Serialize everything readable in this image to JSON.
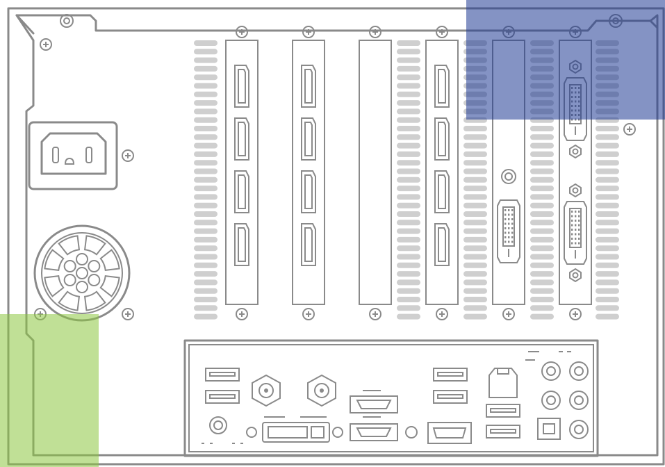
{
  "figure": {
    "kind": "computer rear panel line illustration",
    "stroke_color": "#8a8a8a",
    "vent_color": "#cfcfcf",
    "highlights": [
      {
        "name": "top-right-region",
        "color": "#1f3a93",
        "opacity": 0.55
      },
      {
        "name": "bottom-left-region",
        "color": "#8cc63f",
        "opacity": 0.55
      }
    ],
    "expansion_slots": [
      {
        "name": "gpu-card-1",
        "ports": [
          "displayport",
          "displayport",
          "displayport",
          "displayport"
        ]
      },
      {
        "name": "gpu-card-2",
        "ports": [
          "displayport",
          "displayport",
          "displayport",
          "displayport"
        ]
      },
      {
        "name": "blank-slot-cover",
        "ports": []
      },
      {
        "name": "gpu-card-3",
        "ports": [
          "displayport",
          "displayport",
          "displayport",
          "displayport"
        ]
      },
      {
        "name": "card-dvi-single",
        "ports": [
          "round-jack",
          "dvi"
        ]
      },
      {
        "name": "card-dvi-dual",
        "ports": [
          "dvi",
          "dvi"
        ]
      }
    ],
    "io_panel_ports": [
      "usb",
      "usb",
      "ps2",
      "coax",
      "coax",
      "vga",
      "esata",
      "esata",
      "usb",
      "usb",
      "hdmi",
      "ethernet",
      "usb",
      "usb",
      "audio",
      "optical"
    ]
  }
}
